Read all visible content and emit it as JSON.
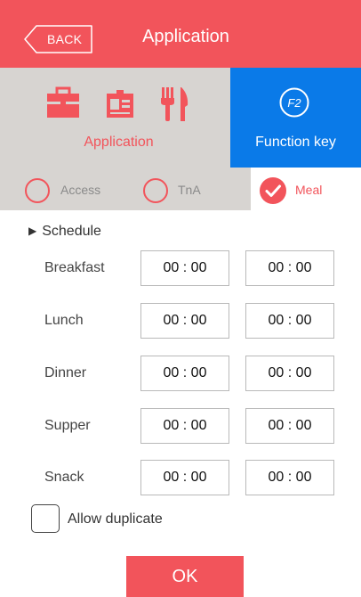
{
  "header": {
    "back_label": "BACK",
    "title": "Application"
  },
  "menu": {
    "application_label": "Application",
    "function_key_label": "Function key",
    "function_key_icon_text": "F2"
  },
  "tabs": [
    {
      "label": "Access",
      "checked": false
    },
    {
      "label": "TnA",
      "checked": false
    },
    {
      "label": "Meal",
      "checked": true
    }
  ],
  "schedule": {
    "heading": "Schedule",
    "meals": [
      {
        "name": "Breakfast",
        "start": "00 : 00",
        "end": "00 : 00"
      },
      {
        "name": "Lunch",
        "start": "00 : 00",
        "end": "00 : 00"
      },
      {
        "name": "Dinner",
        "start": "00 : 00",
        "end": "00 : 00"
      },
      {
        "name": "Supper",
        "start": "00 : 00",
        "end": "00 : 00"
      },
      {
        "name": "Snack",
        "start": "00 : 00",
        "end": "00 : 00"
      }
    ]
  },
  "allow_duplicate": {
    "label": "Allow duplicate",
    "checked": false
  },
  "ok_label": "OK",
  "colors": {
    "accent": "#f2545b",
    "function_key_bg": "#0a7ae8",
    "panel_gray": "#d7d4d1"
  }
}
